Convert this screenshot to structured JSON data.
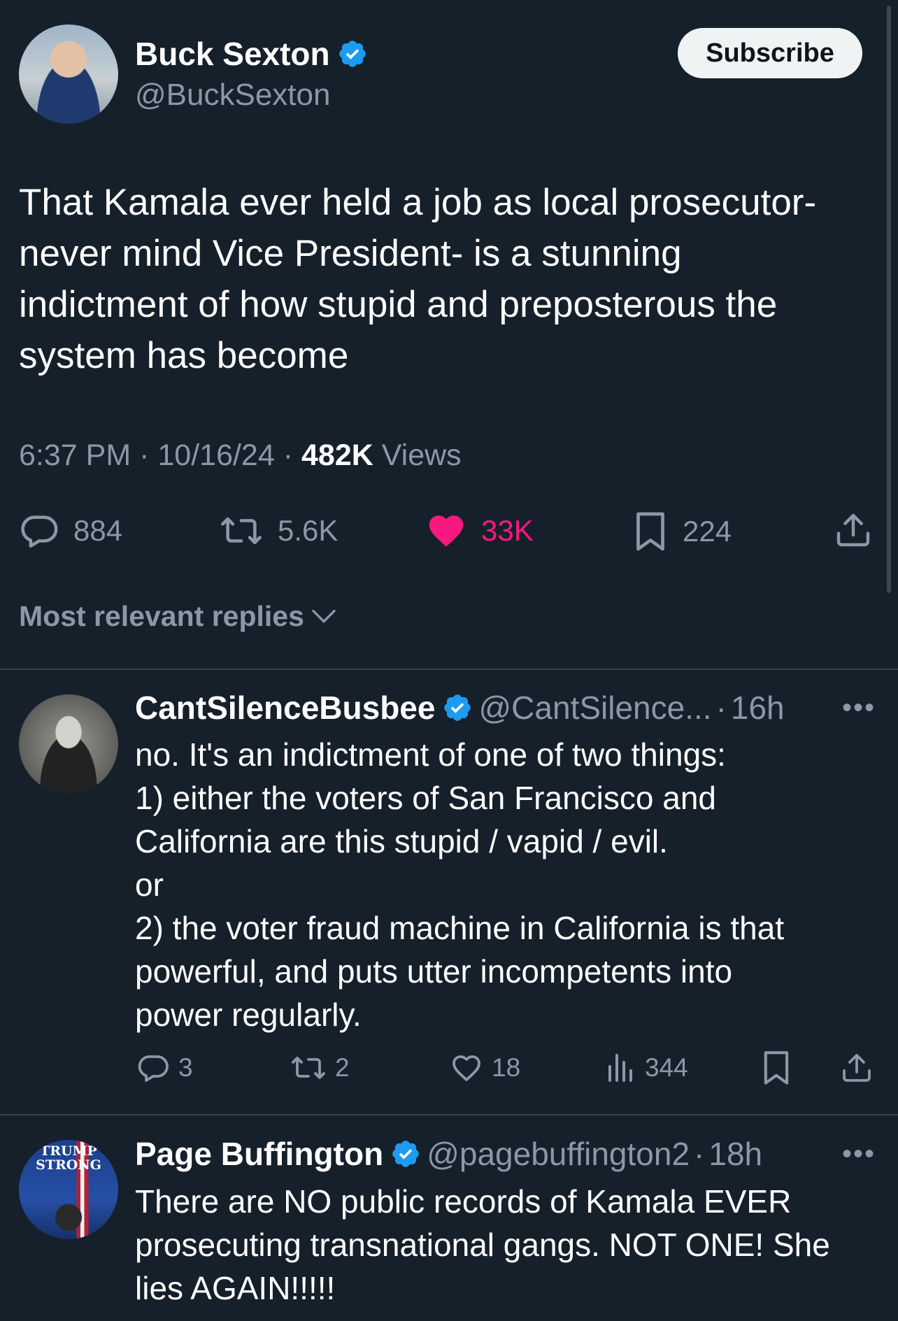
{
  "main_tweet": {
    "author_name": "Buck Sexton",
    "author_handle": "@BuckSexton",
    "subscribe_label": "Subscribe",
    "text": "That Kamala ever held a job as local prosecutor- never mind Vice President- is a stunning indictment of how stupid and preposterous the system has become",
    "time": "6:37 PM",
    "date": "10/16/24",
    "views_count": "482K",
    "views_label": "Views",
    "separator": "·",
    "replies": "884",
    "reposts": "5.6K",
    "likes": "33K",
    "bookmarks": "224"
  },
  "sort_label": "Most relevant replies",
  "replies": [
    {
      "name": "CantSilenceBusbee",
      "handle": "@CantSilence...",
      "time": "16h",
      "lines": [
        "no. It's an indictment of one of two things:",
        "1) either the voters of San Francisco and",
        "California are this stupid / vapid / evil.",
        "or",
        "2) the voter fraud machine in California is that",
        "powerful, and puts utter incompetents into",
        "power regularly."
      ],
      "replies": "3",
      "reposts": "2",
      "likes": "18",
      "views": "344"
    },
    {
      "name": "Page Buffington",
      "handle": "@pagebuffington2",
      "time": "18h",
      "avatar_text": "TRUMP STRONG",
      "lines": [
        "There are NO public records of Kamala EVER",
        "prosecuting transnational gangs.  NOT ONE!  She",
        "lies AGAIN!!!!!"
      ]
    }
  ],
  "colors": {
    "background": "#15202b",
    "muted": "#8b98a5",
    "verified": "#1d9bf0",
    "like": "#f91880"
  }
}
